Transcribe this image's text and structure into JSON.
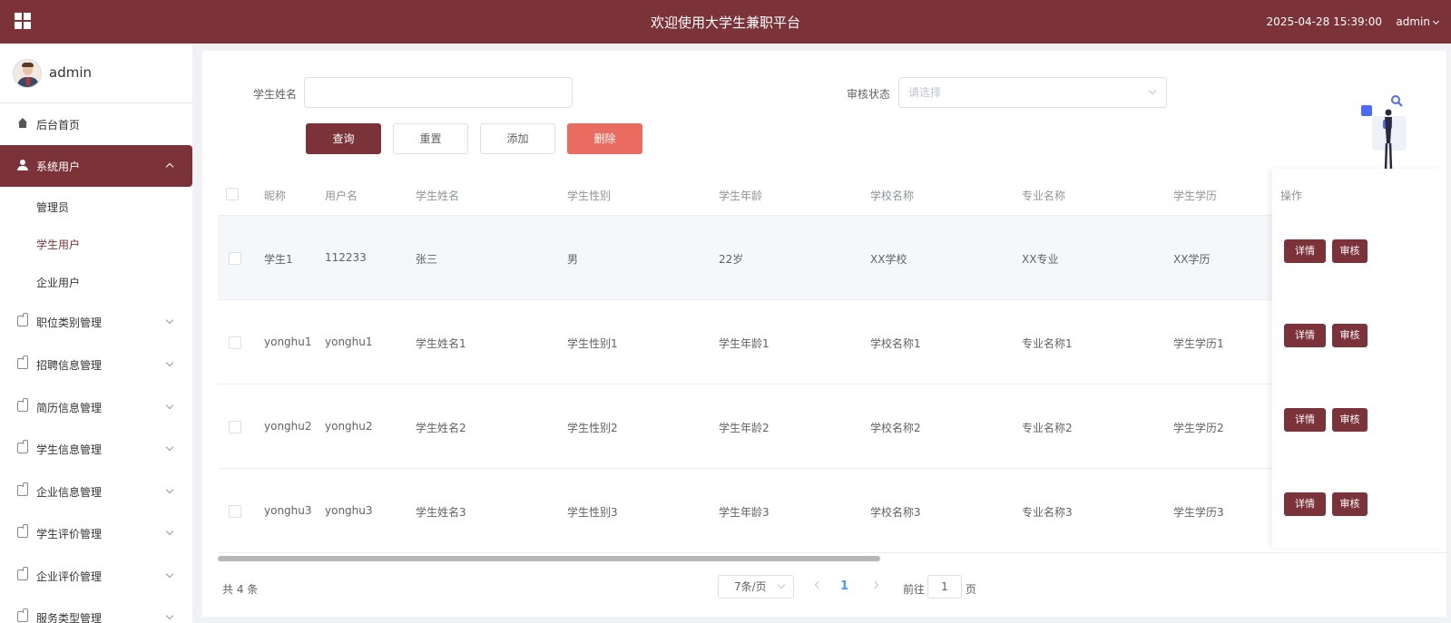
{
  "header": {
    "title": "欢迎使用大学生兼职平台",
    "datetime": "2025-04-28 15:39:00",
    "user": "admin"
  },
  "sidebar": {
    "profile_name": "admin",
    "items": [
      {
        "label": "后台首页",
        "icon": "home-icon"
      },
      {
        "label": "系统用户",
        "icon": "user-icon"
      },
      {
        "label": "职位类别管理",
        "icon": "doc-icon"
      },
      {
        "label": "招聘信息管理",
        "icon": "doc-icon"
      },
      {
        "label": "简历信息管理",
        "icon": "doc-icon"
      },
      {
        "label": "学生信息管理",
        "icon": "doc-icon"
      },
      {
        "label": "企业信息管理",
        "icon": "doc-icon"
      },
      {
        "label": "学生评价管理",
        "icon": "doc-icon"
      },
      {
        "label": "企业评价管理",
        "icon": "doc-icon"
      },
      {
        "label": "服务类型管理",
        "icon": "doc-icon"
      }
    ],
    "sub_items": [
      "管理员",
      "学生用户",
      "企业用户"
    ]
  },
  "search": {
    "name_label": "学生姓名",
    "name_value": "",
    "status_label": "审核状态",
    "status_placeholder": "请选择"
  },
  "actions": {
    "query": "查询",
    "reset": "重置",
    "add": "添加",
    "delete": "删除"
  },
  "table": {
    "columns": [
      "昵称",
      "用户名",
      "学生姓名",
      "学生性别",
      "学生年龄",
      "学校名称",
      "专业名称",
      "学生学历",
      "操作"
    ],
    "rows": [
      [
        "学生1",
        "112233",
        "张三",
        "男",
        "22岁",
        "XX学校",
        "XX专业",
        "XX学历"
      ],
      [
        "yonghu1",
        "yonghu1",
        "学生姓名1",
        "学生性别1",
        "学生年龄1",
        "学校名称1",
        "专业名称1",
        "学生学历1"
      ],
      [
        "yonghu2",
        "yonghu2",
        "学生姓名2",
        "学生性别2",
        "学生年龄2",
        "学校名称2",
        "专业名称2",
        "学生学历2"
      ],
      [
        "yonghu3",
        "yonghu3",
        "学生姓名3",
        "学生性别3",
        "学生年龄3",
        "学校名称3",
        "专业名称3",
        "学生学历3"
      ]
    ],
    "detail_label": "详情",
    "audit_label": "审核"
  },
  "pagination": {
    "total": "共 4 条",
    "page_size": "7条/页",
    "current_page": "1",
    "goto_prefix": "前往",
    "goto_value": "1",
    "goto_suffix": "页"
  },
  "colors": {
    "brand": "#7b3339",
    "danger": "#ea6b5f",
    "page_active": "#409eff"
  }
}
